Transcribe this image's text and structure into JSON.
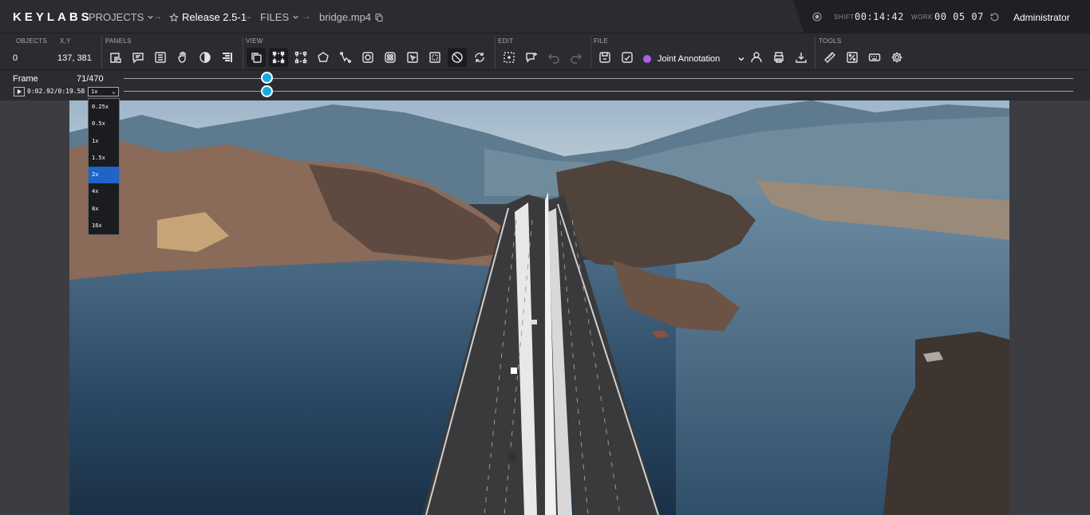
{
  "header": {
    "logo": "KEYLABS",
    "projects_label": "PROJECTS",
    "project_name": "Release 2.5-1",
    "files_label": "FILES",
    "file_name": "bridge.mp4",
    "shift_label": "SHIFT",
    "shift_time": "00:14:42",
    "work_label": "WORK",
    "work_time": "00 05 07",
    "user": "Administrator"
  },
  "toolbar": {
    "objects_label": "OBJECTS",
    "objects_value": "0",
    "xy_label": "X,Y",
    "xy_value": "137, 381",
    "panels_label": "PANELS",
    "view_label": "VIEW",
    "edit_label": "EDIT",
    "file_label": "FILE",
    "tools_label": "TOOLS",
    "annotation_mode": "Joint Annotation",
    "annotation_color": "#b35ee8"
  },
  "timeline": {
    "frame_label": "Frame",
    "frame_value": "71/470",
    "timecode": "0:02.92/0:19.58",
    "speed_selected": "1x",
    "progress": 0.151
  },
  "speed_options": [
    {
      "label": "0.25x"
    },
    {
      "label": "0.5x"
    },
    {
      "label": "1x"
    },
    {
      "label": "1.5x"
    },
    {
      "label": "2x"
    },
    {
      "label": "4x"
    },
    {
      "label": "8x"
    },
    {
      "label": "16x"
    }
  ],
  "speed_highlighted": "2x",
  "colors": {
    "accent": "#1aa6e6",
    "selection": "#1f64c7"
  }
}
